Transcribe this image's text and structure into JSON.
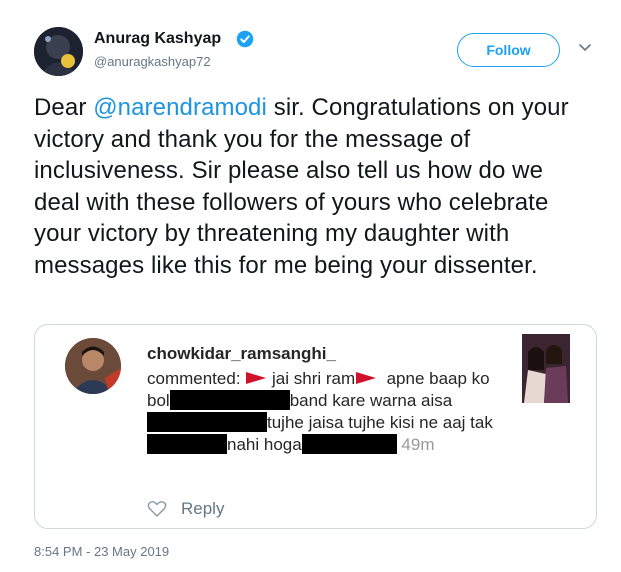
{
  "user": {
    "name": "Anurag Kashyap",
    "handle": "@anuragkashyap72",
    "verified": true
  },
  "actions": {
    "follow_label": "Follow",
    "menu_icon": "chevron-down-icon"
  },
  "tweet": {
    "text_before_mention": "Dear ",
    "mention": "@narendramodi",
    "text_after_mention": " sir. Congratulations on your victory and thank you for the message of inclusiveness. Sir please also tell us how do we deal with these followers of yours who celebrate your victory by threatening my daughter with messages like this for me being your dissenter.",
    "timestamp": "8:54 PM - 23 May 2019"
  },
  "embedded_comment": {
    "username": "chowkidar_ramsanghi_",
    "commented_label": "commented:",
    "segment_1": "jai shri ram",
    "segment_2": "apne baap ko bol",
    "segment_3": "band kare warna aisa",
    "segment_4": "tujhe jaisa tujhe kisi ne aaj tak",
    "segment_5": "nahi hoga",
    "time_ago": "49m",
    "reply_label": "Reply"
  },
  "colors": {
    "accent": "#1da1f2",
    "mention": "#1b95e0",
    "muted": "#657786",
    "flag": "#d0112b"
  }
}
